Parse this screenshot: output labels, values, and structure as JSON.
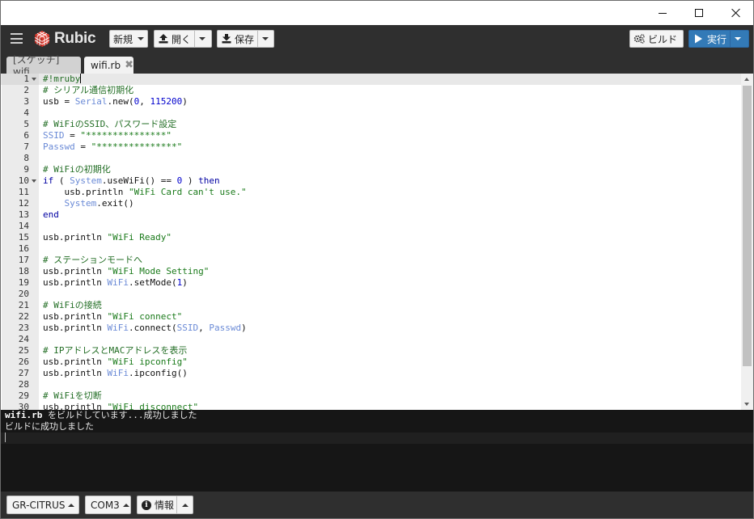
{
  "window": {
    "controls": [
      "minimize",
      "maximize",
      "close"
    ]
  },
  "toolbar": {
    "app_name": "Rubic",
    "new_label": "新規",
    "open_label": "開く",
    "save_label": "保存",
    "build_label": "ビルド",
    "run_label": "実行",
    "accent_color": "#337ab7",
    "logo_color": "#d9362b"
  },
  "tabs": [
    {
      "label": "[スケッチ] wifi",
      "active": false
    },
    {
      "label": "wifi.rb",
      "active": true,
      "close_glyph": "✖"
    }
  ],
  "editor": {
    "lines": [
      {
        "n": "1",
        "fold": true,
        "active": true,
        "tokens": [
          [
            "c-cm",
            "#!mruby"
          ]
        ],
        "cursor": true
      },
      {
        "n": "2",
        "tokens": [
          [
            "c-cm",
            "# シリアル通信初期化"
          ]
        ]
      },
      {
        "n": "3",
        "tokens": [
          [
            "",
            "usb = "
          ],
          [
            "c-const",
            "Serial"
          ],
          [
            "",
            ".new("
          ],
          [
            "c-num",
            "0"
          ],
          [
            "",
            ", "
          ],
          [
            "c-num",
            "115200"
          ],
          [
            "",
            ")"
          ]
        ]
      },
      {
        "n": "4",
        "tokens": []
      },
      {
        "n": "5",
        "tokens": [
          [
            "c-cm",
            "# WiFiのSSID、パスワード設定"
          ]
        ]
      },
      {
        "n": "6",
        "tokens": [
          [
            "c-const",
            "SSID"
          ],
          [
            "",
            " = "
          ],
          [
            "c-str",
            "\"***************\""
          ]
        ]
      },
      {
        "n": "7",
        "tokens": [
          [
            "c-const",
            "Passwd"
          ],
          [
            "",
            " = "
          ],
          [
            "c-str",
            "\"***************\""
          ]
        ]
      },
      {
        "n": "8",
        "tokens": []
      },
      {
        "n": "9",
        "tokens": [
          [
            "c-cm",
            "# WiFiの初期化"
          ]
        ]
      },
      {
        "n": "10",
        "fold": true,
        "tokens": [
          [
            "c-kw",
            "if"
          ],
          [
            "",
            " ( "
          ],
          [
            "c-const",
            "System"
          ],
          [
            "",
            ".useWiFi() == "
          ],
          [
            "c-num",
            "0"
          ],
          [
            "",
            " ) "
          ],
          [
            "c-kw",
            "then"
          ]
        ]
      },
      {
        "n": "11",
        "tokens": [
          [
            "",
            "    usb.println "
          ],
          [
            "c-str",
            "\"WiFi Card can't use.\""
          ]
        ]
      },
      {
        "n": "12",
        "tokens": [
          [
            "",
            "    "
          ],
          [
            "c-const",
            "System"
          ],
          [
            "",
            ".exit()"
          ]
        ]
      },
      {
        "n": "13",
        "tokens": [
          [
            "c-kw",
            "end"
          ]
        ]
      },
      {
        "n": "14",
        "tokens": []
      },
      {
        "n": "15",
        "tokens": [
          [
            "",
            "usb.println "
          ],
          [
            "c-str",
            "\"WiFi Ready\""
          ]
        ]
      },
      {
        "n": "16",
        "tokens": []
      },
      {
        "n": "17",
        "tokens": [
          [
            "c-cm",
            "# ステーションモードへ"
          ]
        ]
      },
      {
        "n": "18",
        "tokens": [
          [
            "",
            "usb.println "
          ],
          [
            "c-str",
            "\"WiFi Mode Setting\""
          ]
        ]
      },
      {
        "n": "19",
        "tokens": [
          [
            "",
            "usb.println "
          ],
          [
            "c-const",
            "WiFi"
          ],
          [
            "",
            ".setMode("
          ],
          [
            "c-num",
            "1"
          ],
          [
            "",
            ")"
          ]
        ]
      },
      {
        "n": "20",
        "tokens": []
      },
      {
        "n": "21",
        "tokens": [
          [
            "c-cm",
            "# WiFiの接続"
          ]
        ]
      },
      {
        "n": "22",
        "tokens": [
          [
            "",
            "usb.println "
          ],
          [
            "c-str",
            "\"WiFi connect\""
          ]
        ]
      },
      {
        "n": "23",
        "tokens": [
          [
            "",
            "usb.println "
          ],
          [
            "c-const",
            "WiFi"
          ],
          [
            "",
            ".connect("
          ],
          [
            "c-const",
            "SSID"
          ],
          [
            "",
            ", "
          ],
          [
            "c-const",
            "Passwd"
          ],
          [
            "",
            ")"
          ]
        ]
      },
      {
        "n": "24",
        "tokens": []
      },
      {
        "n": "25",
        "tokens": [
          [
            "c-cm",
            "# IPアドレスとMACアドレスを表示"
          ]
        ]
      },
      {
        "n": "26",
        "tokens": [
          [
            "",
            "usb.println "
          ],
          [
            "c-str",
            "\"WiFi ipconfig\""
          ]
        ]
      },
      {
        "n": "27",
        "tokens": [
          [
            "",
            "usb.println "
          ],
          [
            "c-const",
            "WiFi"
          ],
          [
            "",
            ".ipconfig()"
          ]
        ]
      },
      {
        "n": "28",
        "tokens": []
      },
      {
        "n": "29",
        "tokens": [
          [
            "c-cm",
            "# WiFiを切断"
          ]
        ]
      },
      {
        "n": "30",
        "tokens": [
          [
            "",
            "usb.println "
          ],
          [
            "c-str",
            "\"WiFi disconnect\""
          ]
        ]
      }
    ]
  },
  "console": {
    "line1_file": "wifi.rb",
    "line1_rest": " をビルドしています...成功しました",
    "line2": "ビルドに成功しました"
  },
  "statusbar": {
    "board_label": "GR-CITRUS",
    "port_label": "COM3",
    "info_label": "情報"
  }
}
